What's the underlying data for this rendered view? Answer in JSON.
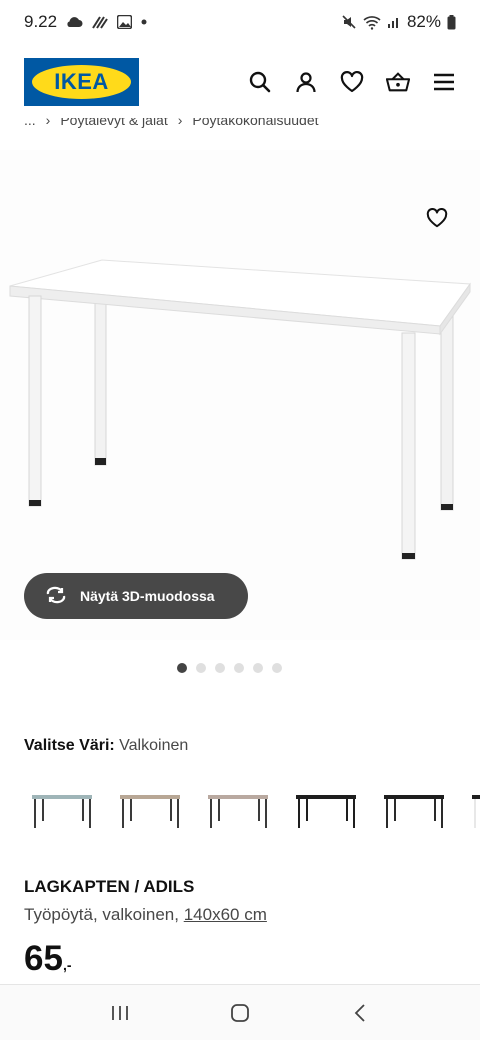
{
  "status_bar": {
    "time": "9.22",
    "battery": "82%",
    "left_icons": [
      "cloud-icon",
      "data-saver-icon",
      "image-icon",
      "dot-icon"
    ],
    "right_icons": [
      "mute-icon",
      "wifi-icon",
      "signal-icon",
      "battery-icon"
    ]
  },
  "header": {
    "logo_text": "IKEA",
    "icons": [
      "search-icon",
      "account-icon",
      "wishlist-icon",
      "cart-icon",
      "menu-icon"
    ]
  },
  "breadcrumb": {
    "ellipsis": "...",
    "items": [
      "Pöytälevyt & jalat",
      "Pöytäkokonaisuudet"
    ]
  },
  "gallery": {
    "button_3d_label": "Näytä 3D-muodossa",
    "dot_count": 6,
    "active_dot": 0
  },
  "color_select": {
    "label": "Valitse Väri:",
    "value": "Valkoinen",
    "swatches": [
      {
        "top": "#9fb5b8",
        "legs": "#3a3a3a"
      },
      {
        "top": "#b8a795",
        "legs": "#3a3a3a"
      },
      {
        "top": "#b9a9a0",
        "legs": "#3a3a3a"
      },
      {
        "top": "#1e1e1e",
        "legs": "#1e1e1e"
      },
      {
        "top": "#1e1e1e",
        "legs": "#2a2a2a"
      },
      {
        "top": "#1e1e1e",
        "legs": "#e8e8e8"
      }
    ]
  },
  "product": {
    "name": "LAGKAPTEN / ADILS",
    "description": "Työpöytä, valkoinen,",
    "size": "140x60 cm",
    "price": "65",
    "price_suffix": ",-"
  },
  "nav_bar": {
    "icons": [
      "recent-apps-icon",
      "home-icon",
      "back-icon"
    ]
  }
}
